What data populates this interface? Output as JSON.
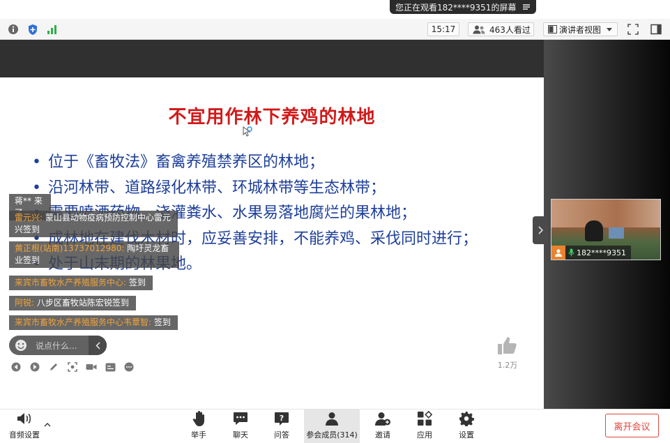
{
  "share_banner": {
    "text": "您正在观看182****9351的屏幕"
  },
  "toolbar": {
    "time": "15:17",
    "viewers": "463人看过",
    "view_mode": "演讲者视图"
  },
  "slide": {
    "title": "不宜用作林下养鸡的林地",
    "bullets": [
      {
        "dot": "•",
        "text": "位于《畜牧法》畜禽养殖禁养区的林地；"
      },
      {
        "dot": "•",
        "text": "沿河林带、道路绿化林带、环城林带等生态林带；"
      },
      {
        "dot": "•",
        "text": "需要喷洒药物、浇灌粪水、水果易落地腐烂的果林地；"
      },
      {
        "dot": "•",
        "text": "成林地在建伐木材时，应妥善安排，不能养鸡、采伐同时进行；"
      },
      {
        "dot": "•",
        "text": "处于山末期的林果地。"
      }
    ]
  },
  "chat": {
    "messages": [
      {
        "nick": "",
        "text": "蒋** 来了"
      },
      {
        "nick": "雷元兴:",
        "text": " 蒙山县动物疫病预防控制中心雷元兴签到"
      },
      {
        "nick": "黄正根(站南)13737012980:",
        "text": " 陶圩灵龙畜业签到"
      },
      {
        "nick": "来宾市畜牧水产养殖服务中心:",
        "text": " 签到"
      },
      {
        "nick": "阿锐:",
        "text": " 八步区畜牧站陈宏锐签到"
      },
      {
        "nick": "来宾市畜牧水产养殖服务中心韦覃智:",
        "text": " 签到"
      }
    ],
    "input_placeholder": "说点什么..."
  },
  "like": {
    "count": "1.2万"
  },
  "video": {
    "name": "182****9351"
  },
  "bottombar": {
    "audio": "音频设置",
    "raise_hand": "举手",
    "chat": "聊天",
    "qa": "问答",
    "participants": "参会成员(314)",
    "invite": "邀请",
    "apps": "应用",
    "settings": "设置",
    "leave": "离开会议"
  },
  "colors": {
    "slide_title": "#d11a1a",
    "slide_text": "#1e3f99",
    "chat_nick": "#f2a33a",
    "leave": "#e0463a"
  }
}
